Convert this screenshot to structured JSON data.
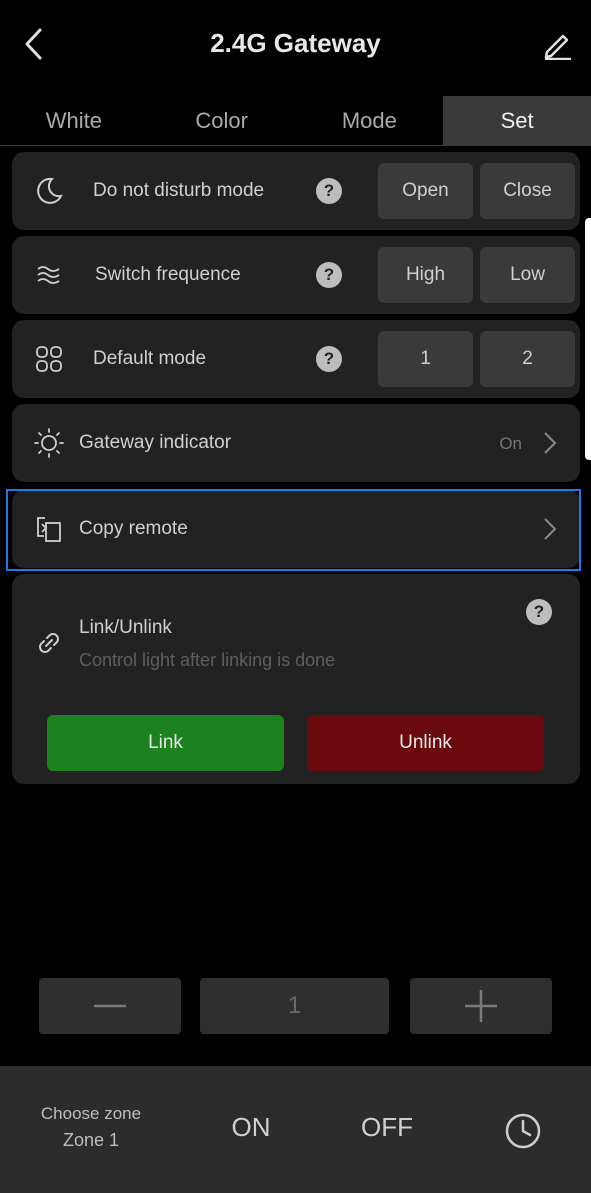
{
  "header": {
    "title": "2.4G Gateway",
    "back_icon": "chevron-left-icon",
    "edit_icon": "pencil-icon"
  },
  "tabs": [
    {
      "label": "White",
      "active": false
    },
    {
      "label": "Color",
      "active": false
    },
    {
      "label": "Mode",
      "active": false
    },
    {
      "label": "Set",
      "active": true
    }
  ],
  "settings": {
    "dnd": {
      "label": "Do not disturb mode",
      "icon": "moon-icon",
      "options": [
        "Open",
        "Close"
      ]
    },
    "freq": {
      "label": "Switch frequence",
      "icon": "waves-icon",
      "options": [
        "High",
        "Low"
      ]
    },
    "default_mode": {
      "label": "Default mode",
      "icon": "grid-icon",
      "options": [
        "1",
        "2"
      ]
    },
    "indicator": {
      "label": "Gateway indicator",
      "icon": "sun-icon",
      "value": "On"
    },
    "copy_remote": {
      "label": "Copy remote",
      "icon": "copy-remote-icon"
    },
    "link": {
      "label": "Link/Unlink",
      "subtitle": "Control light after linking is done",
      "icon": "link-icon",
      "link_button": "Link",
      "unlink_button": "Unlink"
    }
  },
  "stepper": {
    "value": "1"
  },
  "bottom_bar": {
    "zone_title": "Choose zone",
    "zone_value": "Zone 1",
    "on_label": "ON",
    "off_label": "OFF",
    "timer_icon": "clock-icon"
  },
  "colors": {
    "accent": "#1e7be6",
    "link": "#1c8220",
    "unlink": "#6a0a0e",
    "card": "#222222"
  }
}
